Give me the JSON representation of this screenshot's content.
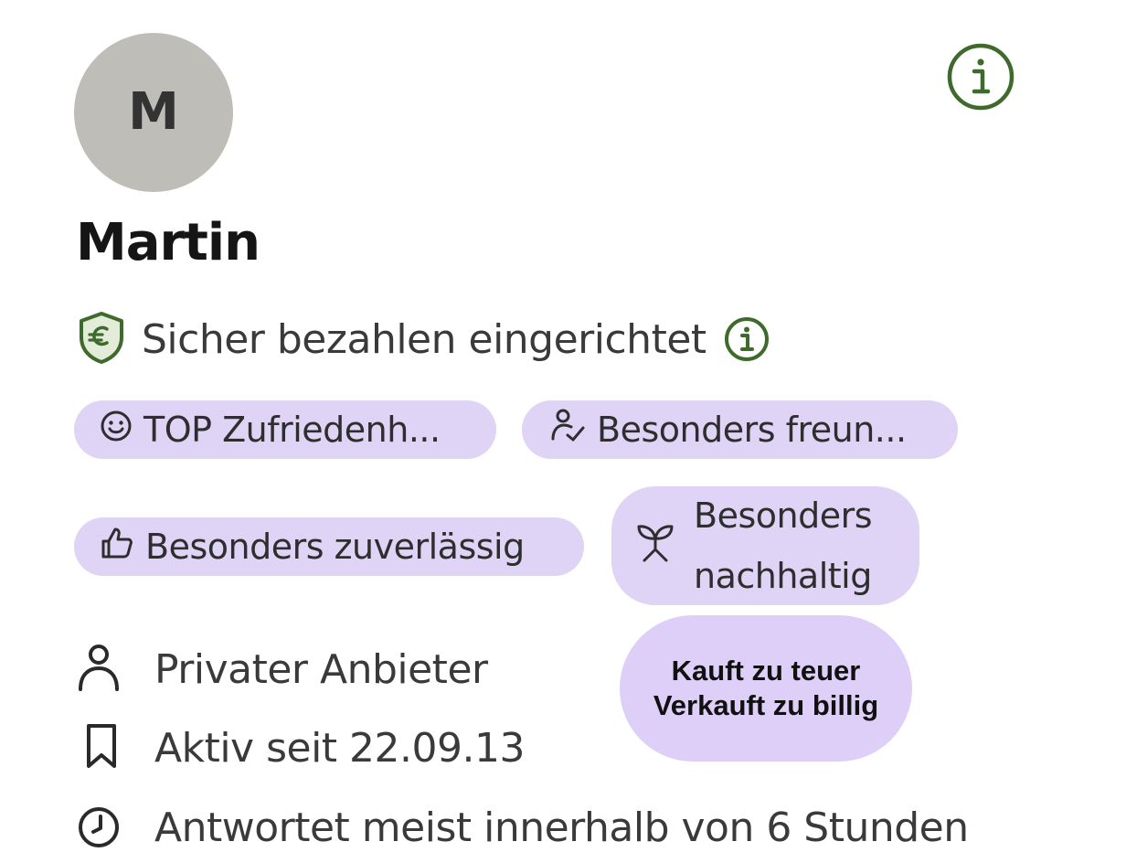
{
  "profile": {
    "avatar_initial": "M",
    "name": "Martin",
    "secure_payment": "Sicher bezahlen eingerichtet"
  },
  "badges": [
    {
      "icon": "smiley-icon",
      "label": "TOP Zufriedenh..."
    },
    {
      "icon": "friendly-person-icon",
      "label": "Besonders freun..."
    },
    {
      "icon": "thumbs-up-icon",
      "label": "Besonders zuverlässig"
    },
    {
      "icon": "plant-sprout-icon",
      "label": "Besonders nachhaltig"
    }
  ],
  "overlay": {
    "line1": "Kauft zu teuer",
    "line2": "Verkauft zu billig"
  },
  "details": [
    {
      "icon": "person-icon",
      "text": "Privater Anbieter"
    },
    {
      "icon": "bookmark-icon",
      "text": "Aktiv seit 22.09.13"
    },
    {
      "icon": "clock-icon",
      "text": "Antwortet meist innerhalb von 6 Stunden"
    }
  ],
  "colors": {
    "accent_green": "#3e6b2c",
    "badge_bg": "#e0d4f6",
    "avatar_bg": "#bfbdb8",
    "text_dark": "#151515",
    "text_muted": "#3a3a3a"
  }
}
